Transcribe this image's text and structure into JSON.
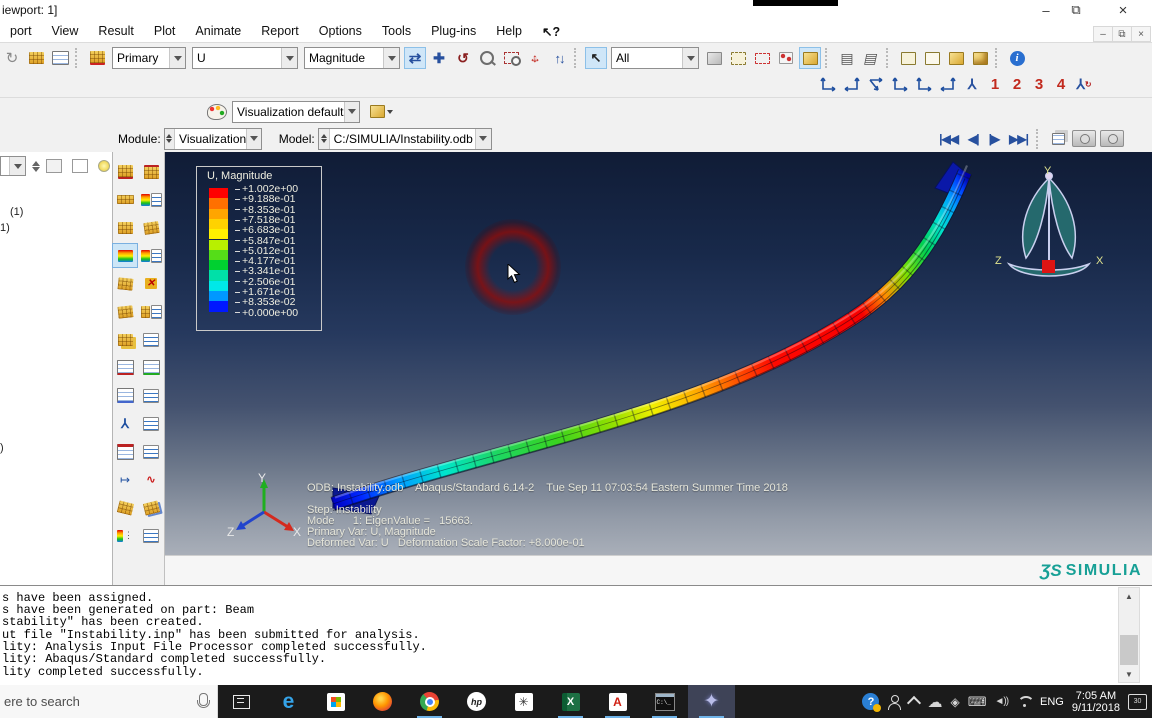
{
  "window": {
    "title": "iewport: 1]"
  },
  "menu": {
    "items": [
      "port",
      "View",
      "Result",
      "Plot",
      "Animate",
      "Report",
      "Options",
      "Tools",
      "Plug-ins",
      "Help"
    ],
    "context_help_glyph": "↖?"
  },
  "toolbars": {
    "field": {
      "position": "Primary",
      "variable": "U",
      "refinement": "Magnitude"
    },
    "selection_filter": "All",
    "view_numbers": [
      "1",
      "2",
      "3",
      "4"
    ],
    "color_code": "Visualization defaults"
  },
  "context_bar": {
    "module_label": "Module:",
    "module": "Visualization",
    "model_label": "Model:",
    "model": "C:/SIMULIA/Instability.odb"
  },
  "tree": {
    "fragments": [
      "(1)",
      "1)",
      ")"
    ]
  },
  "viewport": {
    "legend": {
      "title": "U, Magnitude",
      "values": [
        "+1.002e+00",
        "+9.188e-01",
        "+8.353e-01",
        "+7.518e-01",
        "+6.683e-01",
        "+5.847e-01",
        "+5.012e-01",
        "+4.177e-01",
        "+3.341e-01",
        "+2.506e-01",
        "+1.671e-01",
        "+8.353e-02",
        "+0.000e+00"
      ],
      "colors": [
        "#ff0000",
        "#ff7000",
        "#ffa500",
        "#ffd200",
        "#fff000",
        "#b8f000",
        "#55dd18",
        "#00d030",
        "#00e0a8",
        "#00e8e8",
        "#0098ff",
        "#0018ff"
      ]
    },
    "annotations": {
      "line1": "ODB: Instability.odb    Abaqus/Standard 6.14-2    Tue Sep 11 07:03:54 Eastern Summer Time 2018",
      "step": "Step: Instability",
      "mode": "Mode      1: EigenValue =   15663.",
      "primary_var": "Primary Var: U, Magnitude",
      "deformed_var": "Deformed Var: U   Deformation Scale Factor: +8.000e-01"
    },
    "triad": {
      "x": "X",
      "y": "Y",
      "z": "Z"
    },
    "compass": {
      "x": "X",
      "y": "Y",
      "z": "Z"
    }
  },
  "branding": {
    "ds_glyph": "ƷS",
    "name": "SIMULIA",
    "color": "#17a096"
  },
  "console": {
    "lines": [
      "s have been assigned.",
      "s have been generated on part: Beam",
      "stability\" has been created.",
      "ut file \"Instability.inp\" has been submitted for analysis.",
      "lity: Analysis Input File Processor completed successfully.",
      "lity: Abaqus/Standard completed successfully.",
      "lity completed successfully."
    ]
  },
  "taskbar": {
    "search_text": "ere to search",
    "tray": {
      "language": "ENG",
      "time": "7:05 AM",
      "date": "9/11/2018",
      "notifications": "30"
    }
  }
}
